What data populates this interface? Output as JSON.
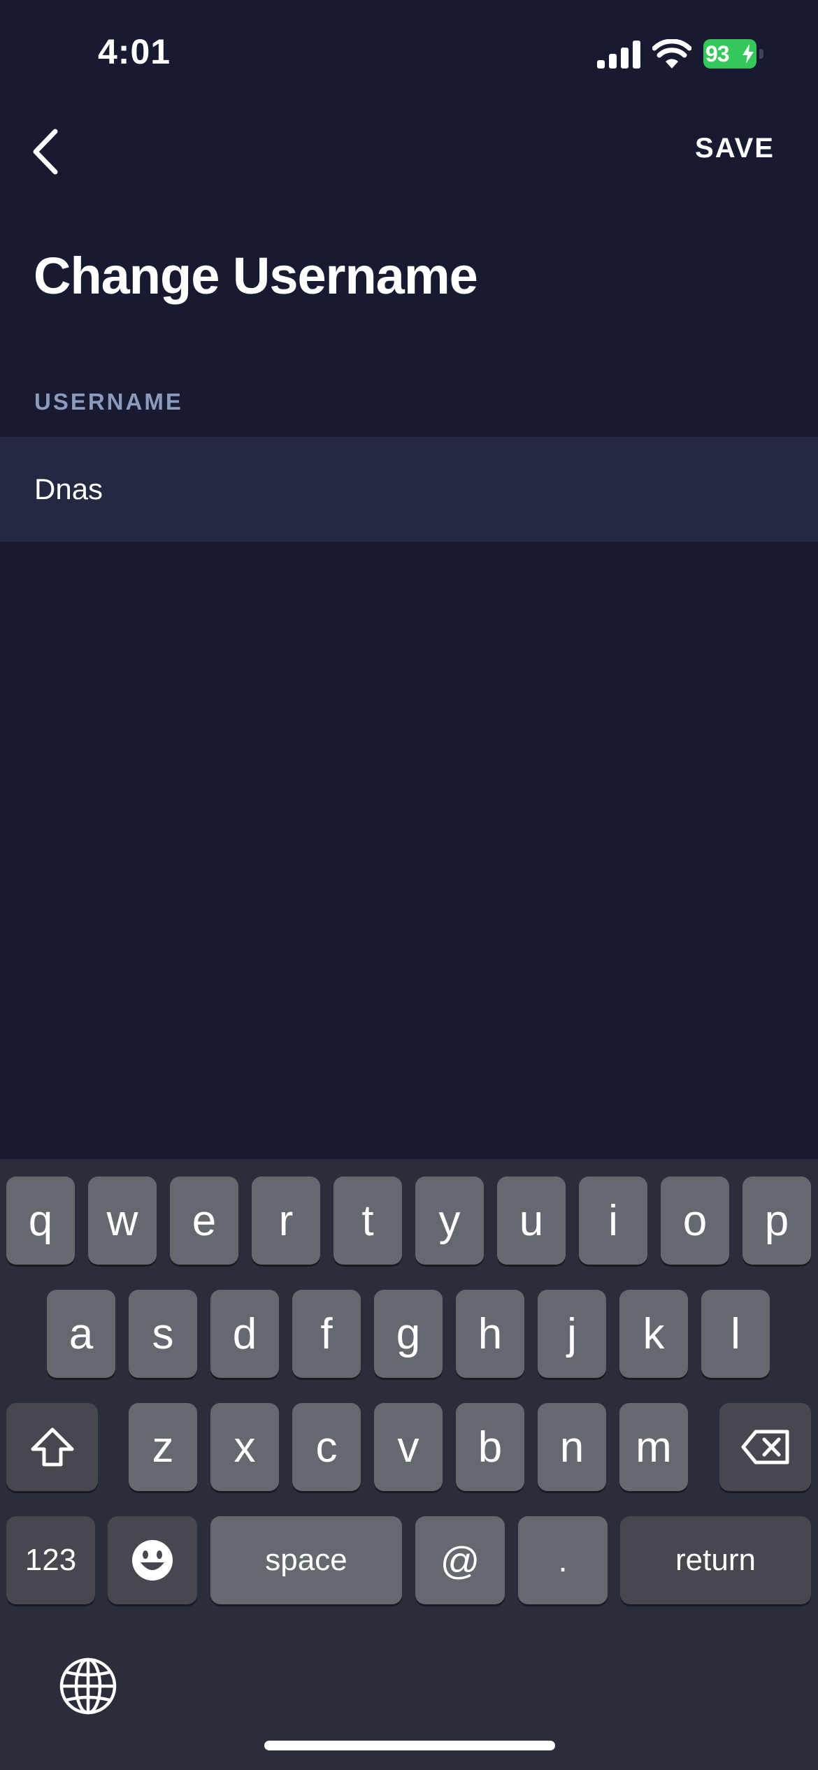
{
  "status_bar": {
    "time": "4:01",
    "battery_level": "93"
  },
  "nav": {
    "save_label": "SAVE"
  },
  "page": {
    "title": "Change Username"
  },
  "form": {
    "username_label": "USERNAME",
    "username_value": "Dnas"
  },
  "keyboard": {
    "row1": [
      "q",
      "w",
      "e",
      "r",
      "t",
      "y",
      "u",
      "i",
      "o",
      "p"
    ],
    "row2": [
      "a",
      "s",
      "d",
      "f",
      "g",
      "h",
      "j",
      "k",
      "l"
    ],
    "row3": [
      "z",
      "x",
      "c",
      "v",
      "b",
      "n",
      "m"
    ],
    "numbers_label": "123",
    "space_label": "space",
    "at_label": "@",
    "dot_label": ".",
    "return_label": "return"
  },
  "colors": {
    "background": "#181a31",
    "field_background": "#242840",
    "label_color": "#8c9abb",
    "battery_green": "#34c759",
    "keyboard_background": "#2c2d3a"
  },
  "icons": {
    "back": "chevron-left-icon",
    "signal": "cellular-signal-icon",
    "wifi": "wifi-icon",
    "battery": "battery-charging-icon",
    "shift": "shift-icon",
    "delete": "backspace-icon",
    "emoji": "emoji-icon",
    "globe": "globe-icon"
  }
}
